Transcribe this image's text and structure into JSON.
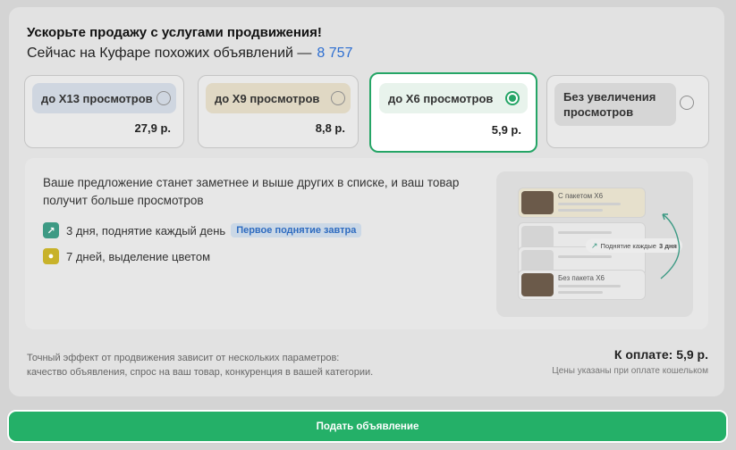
{
  "promo": {
    "title": "Ускорьте продажу с услугами продвижения!",
    "similar_prefix": "Сейчас на Куфаре похожих объявлений —",
    "similar_count": "8 757"
  },
  "options": [
    {
      "label": "до X13 просмотров",
      "price": "27,9 р.",
      "selected": false
    },
    {
      "label": "до X9 просмотров",
      "price": "8,8 р.",
      "selected": false
    },
    {
      "label": "до X6 просмотров",
      "price": "5,9 р.",
      "selected": true
    },
    {
      "label": "Без увеличения просмотров",
      "price": "",
      "selected": false
    }
  ],
  "details": {
    "description": "Ваше предложение станет заметнее и выше других в списке, и ваш товар получит больше просмотров",
    "features": [
      {
        "icon": "raise-arrow-icon",
        "text": "3 дня, поднятие каждый день",
        "badge": "Первое поднятие завтра"
      },
      {
        "icon": "color-highlight-icon",
        "text": "7 дней, выделение цветом",
        "badge": ""
      }
    ],
    "illustration": {
      "with_label": "С пакетом X6",
      "without_label": "Без пакета X6",
      "ticker_prefix": "Поднятие каждые",
      "ticker_value": "3 дня"
    }
  },
  "footer": {
    "disclaimer_line1": "Точный эффект от продвижения зависит от нескольких параметров:",
    "disclaimer_line2": "качество объявления, спрос на ваш товар, конкуренция в вашей категории.",
    "total": "К оплате: 5,9 р.",
    "price_note": "Цены указаны при оплате кошельком"
  },
  "actions": {
    "submit_label": "Подать объявление"
  },
  "colors": {
    "accent": "#24b068",
    "link": "#2e6fd1"
  }
}
